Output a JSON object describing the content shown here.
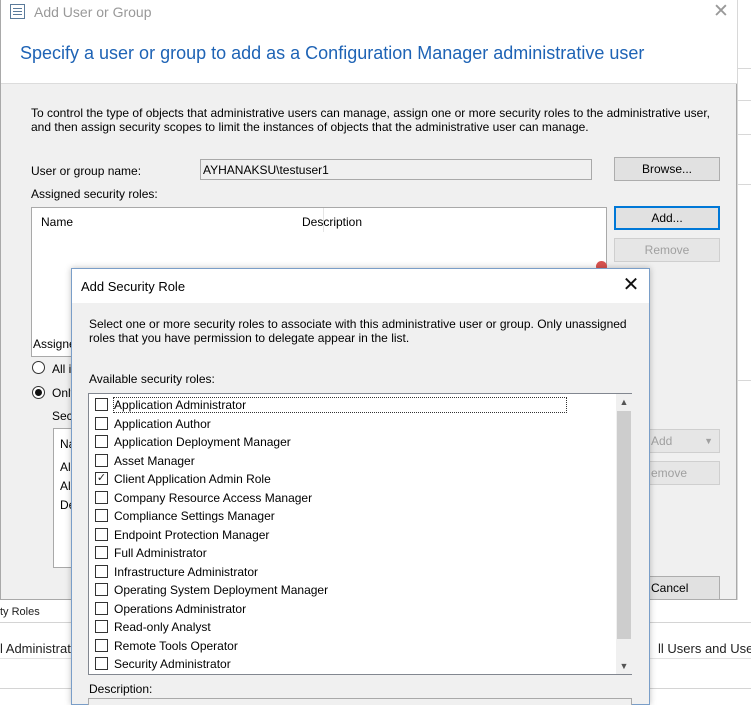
{
  "background": {
    "tab_fragment": "ty Roles",
    "row_left": "l Administrat",
    "row_right": "ll Users and User"
  },
  "main_dialog": {
    "title": "Add User or Group",
    "close_glyph": "✕",
    "header": "Specify a user or group to add as a Configuration Manager administrative user",
    "intro": "To control the type of objects that administrative users can manage, assign one or more security roles  to the  administrative user, and then assign security scopes to limit the instances of objects that the administrative user can manage.",
    "user_label": "User or group name:",
    "user_value": "AYHANAKSU\\testuser1",
    "browse_label": "Browse...",
    "assigned_roles_label": "Assigned security roles:",
    "columns": [
      "Name",
      "Description"
    ],
    "add_label": "Add...",
    "remove_label": "Remove",
    "scope_label_fragment": "Assigne",
    "radio_all_fragment": "All i",
    "radio_only_fragment": "Only",
    "scopes_label_fragment": "Sec",
    "scope_col_fragment": "Na",
    "scope_rows": [
      "All",
      "All",
      "De"
    ],
    "add2_label": "Add",
    "remove2_label": "emove",
    "cancel_label": "Cancel"
  },
  "overlay": {
    "title": "Add Security Role",
    "close_glyph": "✕",
    "instructions": "Select one or more security roles to associate with this administrative user or group.  Only unassigned roles that you have permission to delegate appear in the list.",
    "available_label": "Available security roles:",
    "roles": [
      {
        "label": "Application Administrator",
        "checked": false
      },
      {
        "label": "Application Author",
        "checked": false
      },
      {
        "label": "Application Deployment Manager",
        "checked": false
      },
      {
        "label": "Asset Manager",
        "checked": false
      },
      {
        "label": "Client Application Admin Role",
        "checked": true
      },
      {
        "label": "Company Resource Access Manager",
        "checked": false
      },
      {
        "label": "Compliance Settings Manager",
        "checked": false
      },
      {
        "label": "Endpoint Protection Manager",
        "checked": false
      },
      {
        "label": "Full Administrator",
        "checked": false
      },
      {
        "label": "Infrastructure Administrator",
        "checked": false
      },
      {
        "label": "Operating System Deployment Manager",
        "checked": false
      },
      {
        "label": "Operations Administrator",
        "checked": false
      },
      {
        "label": "Read-only Analyst",
        "checked": false
      },
      {
        "label": "Remote Tools Operator",
        "checked": false
      },
      {
        "label": "Security Administrator",
        "checked": false
      }
    ],
    "description_label": "Description:"
  }
}
